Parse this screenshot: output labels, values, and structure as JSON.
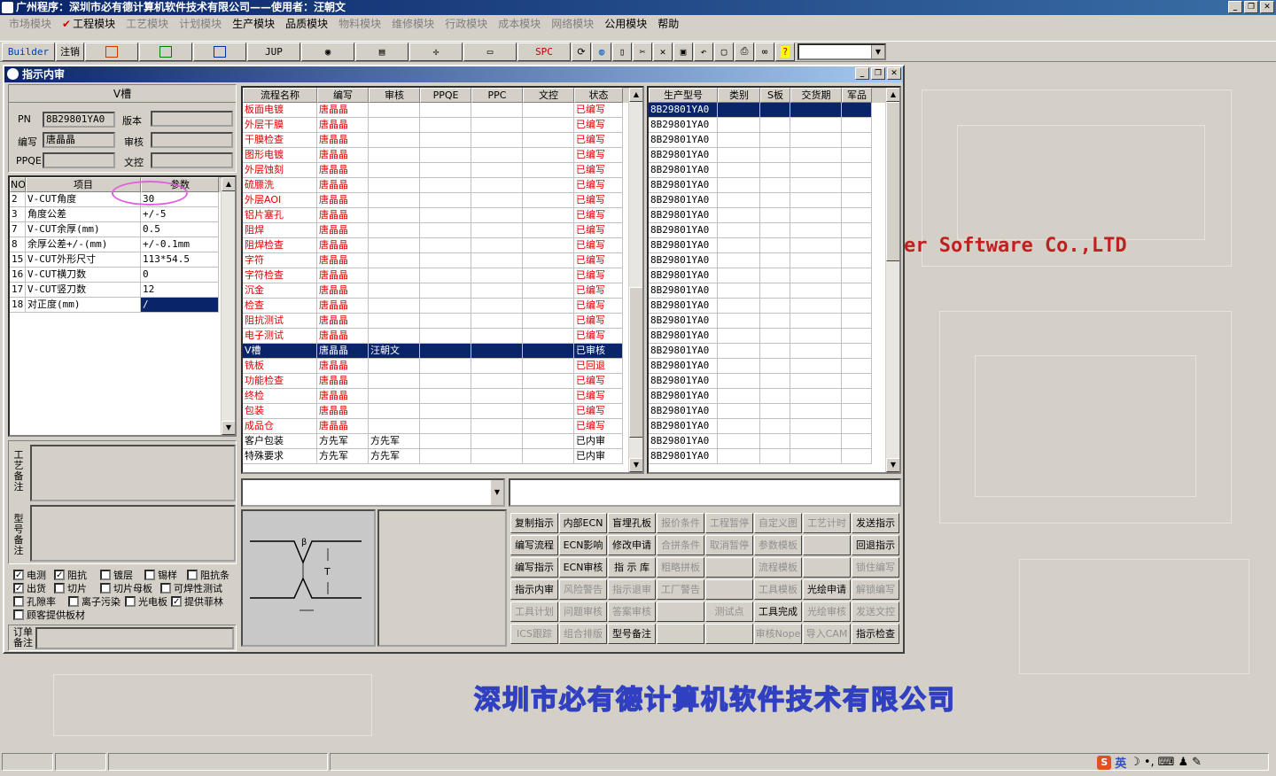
{
  "app": {
    "title": "广州程序：深圳市必有德计算机软件技术有限公司——使用者：汪朝文",
    "window_buttons": [
      "_",
      "❐",
      "✕"
    ]
  },
  "menu": [
    {
      "label": "市场模块",
      "enabled": false
    },
    {
      "label": "工程模块",
      "enabled": true,
      "checked": true
    },
    {
      "label": "工艺模块",
      "enabled": false
    },
    {
      "label": "计划模块",
      "enabled": false
    },
    {
      "label": "生产模块",
      "enabled": true
    },
    {
      "label": "品质模块",
      "enabled": true
    },
    {
      "label": "物料模块",
      "enabled": false
    },
    {
      "label": "维修模块",
      "enabled": false
    },
    {
      "label": "行政模块",
      "enabled": false
    },
    {
      "label": "成本模块",
      "enabled": false
    },
    {
      "label": "网络模块",
      "enabled": false
    },
    {
      "label": "公用模块",
      "enabled": true
    },
    {
      "label": "帮助",
      "enabled": true
    }
  ],
  "toolbar": {
    "builder": "Builder",
    "logout": "注销",
    "jup": "JUP",
    "spc": "SPC"
  },
  "brand": {
    "english": "er Software Co.,LTD",
    "chinese": "深圳市必有德计算机软件技术有限公司"
  },
  "child": {
    "title": "指示内审",
    "process_name": "V槽",
    "pn_label": "PN",
    "pn_value": "8B29801YA0",
    "version_label": "版本",
    "author_label": "编写",
    "author_value": "唐晶晶",
    "review_label": "审核",
    "ppqe_label": "PPQE",
    "doc_label": "文控"
  },
  "params": {
    "columns": [
      "NO",
      "项目",
      "参数"
    ],
    "rows": [
      {
        "no": "2",
        "item": "V-CUT角度",
        "value": "30"
      },
      {
        "no": "3",
        "item": "角度公差",
        "value": "+/-5"
      },
      {
        "no": "7",
        "item": "V-CUT余厚(mm)",
        "value": "0.5"
      },
      {
        "no": "8",
        "item": "余厚公差+/-(mm)",
        "value": "+/-0.1mm"
      },
      {
        "no": "15",
        "item": "V-CUT外形尺寸",
        "value": "113*54.5"
      },
      {
        "no": "16",
        "item": "V-CUT横刀数",
        "value": "0"
      },
      {
        "no": "17",
        "item": "V-CUT竖刀数",
        "value": "12"
      },
      {
        "no": "18",
        "item": "对正度(mm)",
        "value": "/"
      }
    ]
  },
  "notes": {
    "craft": "工艺备注",
    "model": "型号备注",
    "order": "订单备注"
  },
  "checkboxes": [
    {
      "label": "电测",
      "checked": true
    },
    {
      "label": "阻抗",
      "checked": true
    },
    {
      "label": "镀层",
      "checked": false
    },
    {
      "label": "锡样",
      "checked": false
    },
    {
      "label": "阻抗条",
      "checked": false
    },
    {
      "label": "出货",
      "checked": true
    },
    {
      "label": "切片",
      "checked": false
    },
    {
      "label": "切片母板",
      "checked": false
    },
    {
      "label": "可焊性测试",
      "checked": false
    },
    {
      "label": "孔隙率",
      "checked": false
    },
    {
      "label": "离子污染",
      "checked": false
    },
    {
      "label": "光电板",
      "checked": false
    },
    {
      "label": "提供菲林",
      "checked": true
    },
    {
      "label": "顾客提供板材",
      "checked": false
    }
  ],
  "flow": {
    "columns": [
      "流程名称",
      "编写",
      "审核",
      "PPQE",
      "PPC",
      "文控",
      "状态"
    ],
    "rows": [
      {
        "name": "板面电镀",
        "author": "唐晶晶",
        "review": "",
        "status": "已编写",
        "red": true
      },
      {
        "name": "外层干膜",
        "author": "唐晶晶",
        "review": "",
        "status": "已编写",
        "red": true
      },
      {
        "name": "干膜检查",
        "author": "唐晶晶",
        "review": "",
        "status": "已编写",
        "red": true
      },
      {
        "name": "图形电镀",
        "author": "唐晶晶",
        "review": "",
        "status": "已编写",
        "red": true
      },
      {
        "name": "外层蚀刻",
        "author": "唐晶晶",
        "review": "",
        "status": "已编写",
        "red": true
      },
      {
        "name": "硫膘洗",
        "author": "唐晶晶",
        "review": "",
        "status": "已编写",
        "red": true
      },
      {
        "name": "外层AOI",
        "author": "唐晶晶",
        "review": "",
        "status": "已编写",
        "red": true
      },
      {
        "name": "铝片塞孔",
        "author": "唐晶晶",
        "review": "",
        "status": "已编写",
        "red": true
      },
      {
        "name": "阻焊",
        "author": "唐晶晶",
        "review": "",
        "status": "已编写",
        "red": true
      },
      {
        "name": "阻焊检查",
        "author": "唐晶晶",
        "review": "",
        "status": "已编写",
        "red": true
      },
      {
        "name": "字符",
        "author": "唐晶晶",
        "review": "",
        "status": "已编写",
        "red": true
      },
      {
        "name": "字符检查",
        "author": "唐晶晶",
        "review": "",
        "status": "已编写",
        "red": true
      },
      {
        "name": "沉金",
        "author": "唐晶晶",
        "review": "",
        "status": "已编写",
        "red": true
      },
      {
        "name": "检查",
        "author": "唐晶晶",
        "review": "",
        "status": "已编写",
        "red": true
      },
      {
        "name": "阻抗测试",
        "author": "唐晶晶",
        "review": "",
        "status": "已编写",
        "red": true
      },
      {
        "name": "电子测试",
        "author": "唐晶晶",
        "review": "",
        "status": "已编写",
        "red": true
      },
      {
        "name": "V槽",
        "author": "唐晶晶",
        "review": "汪朝文",
        "status": "已审核",
        "red": false,
        "selected": true
      },
      {
        "name": "铣板",
        "author": "唐晶晶",
        "review": "",
        "status": "已回退",
        "red": true
      },
      {
        "name": "功能检查",
        "author": "唐晶晶",
        "review": "",
        "status": "已编写",
        "red": true
      },
      {
        "name": "终检",
        "author": "唐晶晶",
        "review": "",
        "status": "已编写",
        "red": true
      },
      {
        "name": "包装",
        "author": "唐晶晶",
        "review": "",
        "status": "已编写",
        "red": true
      },
      {
        "name": "成品仓",
        "author": "唐晶晶",
        "review": "",
        "status": "已编写",
        "red": true
      },
      {
        "name": "客户包装",
        "author": "方先军",
        "review": "方先军",
        "status": "已内审",
        "red": false
      },
      {
        "name": "特殊要求",
        "author": "方先军",
        "review": "方先军",
        "status": "已内审",
        "red": false
      }
    ]
  },
  "models": {
    "columns": [
      "生产型号",
      "类别",
      "S板",
      "交货期",
      "军品"
    ],
    "value": "8B29801YA0",
    "count": 24
  },
  "buttons": [
    [
      "复制指示",
      "内部ECN",
      "盲埋孔板",
      "报价条件",
      "工程暂停",
      "自定义图",
      "工艺计时",
      "发送指示"
    ],
    [
      "编写流程",
      "ECN影响",
      "修改申请",
      "合拼条件",
      "取消暂停",
      "参数模板",
      "",
      "回退指示"
    ],
    [
      "编写指示",
      "ECN审核",
      "指 示 库",
      "粗略拼板",
      "",
      "流程模板",
      "",
      "锁住编写"
    ],
    [
      "指示内审",
      "风险警告",
      "指示退审",
      "工厂警告",
      "",
      "工具模板",
      "光绘申请",
      "解锁编写"
    ],
    [
      "工具计划",
      "问题审核",
      "答案审核",
      "",
      "测试点",
      "工具完成",
      "光绘审核",
      "发送文控"
    ],
    [
      "ICS跟踪",
      "组合排版",
      "型号备注",
      "",
      "",
      "审核Nope",
      "导入CAM",
      "指示检查"
    ]
  ],
  "buttons_enabled": [
    [
      true,
      true,
      true,
      false,
      false,
      false,
      false,
      true
    ],
    [
      true,
      true,
      true,
      false,
      false,
      false,
      false,
      true
    ],
    [
      true,
      true,
      true,
      false,
      false,
      false,
      false,
      false
    ],
    [
      true,
      false,
      false,
      false,
      false,
      false,
      true,
      false
    ],
    [
      false,
      false,
      false,
      false,
      false,
      true,
      false,
      false
    ],
    [
      false,
      false,
      true,
      false,
      false,
      false,
      false,
      true
    ]
  ],
  "ime": {
    "lang": "英"
  }
}
